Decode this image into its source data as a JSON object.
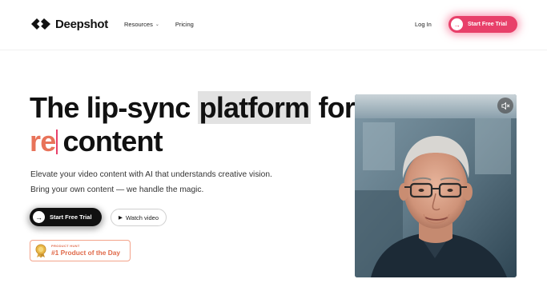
{
  "brand": {
    "name": "Deepshot"
  },
  "nav": {
    "links": [
      {
        "label": "Resources",
        "has_dropdown": true
      },
      {
        "label": "Pricing",
        "has_dropdown": false
      }
    ],
    "login_label": "Log In",
    "cta_label": "Start Free Trial"
  },
  "hero": {
    "headline_part1": "The lip-sync ",
    "headline_highlight": "platform",
    "headline_part2": " for",
    "typed_text": "re",
    "headline_line2_rest": "content",
    "subtitle_line1": "Elevate your video content with AI that understands creative vision.",
    "subtitle_line2": "Bring your own content — we handle the magic.",
    "primary_cta": "Start Free Trial",
    "secondary_cta": "Watch video"
  },
  "badge": {
    "small": "PRODUCT HUNT",
    "big": "#1 Product of the Day"
  },
  "video": {
    "mute_icon": "speaker-muted-icon"
  },
  "colors": {
    "accent_pink": "#e8406a",
    "accent_orange": "#e06a4a",
    "text": "#111111"
  }
}
